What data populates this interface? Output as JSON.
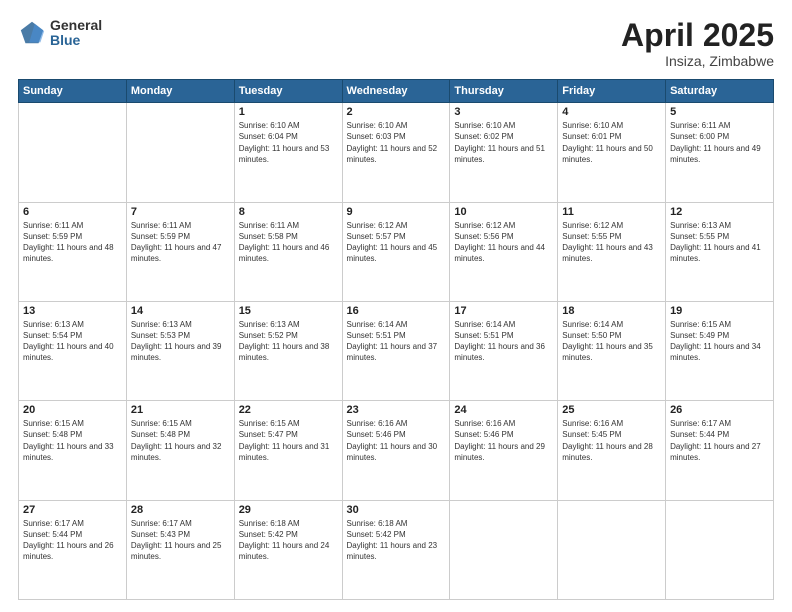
{
  "logo": {
    "general": "General",
    "blue": "Blue"
  },
  "title": {
    "month": "April 2025",
    "location": "Insiza, Zimbabwe"
  },
  "calendar": {
    "headers": [
      "Sunday",
      "Monday",
      "Tuesday",
      "Wednesday",
      "Thursday",
      "Friday",
      "Saturday"
    ],
    "weeks": [
      [
        {
          "day": "",
          "sunrise": "",
          "sunset": "",
          "daylight": ""
        },
        {
          "day": "",
          "sunrise": "",
          "sunset": "",
          "daylight": ""
        },
        {
          "day": "1",
          "sunrise": "Sunrise: 6:10 AM",
          "sunset": "Sunset: 6:04 PM",
          "daylight": "Daylight: 11 hours and 53 minutes."
        },
        {
          "day": "2",
          "sunrise": "Sunrise: 6:10 AM",
          "sunset": "Sunset: 6:03 PM",
          "daylight": "Daylight: 11 hours and 52 minutes."
        },
        {
          "day": "3",
          "sunrise": "Sunrise: 6:10 AM",
          "sunset": "Sunset: 6:02 PM",
          "daylight": "Daylight: 11 hours and 51 minutes."
        },
        {
          "day": "4",
          "sunrise": "Sunrise: 6:10 AM",
          "sunset": "Sunset: 6:01 PM",
          "daylight": "Daylight: 11 hours and 50 minutes."
        },
        {
          "day": "5",
          "sunrise": "Sunrise: 6:11 AM",
          "sunset": "Sunset: 6:00 PM",
          "daylight": "Daylight: 11 hours and 49 minutes."
        }
      ],
      [
        {
          "day": "6",
          "sunrise": "Sunrise: 6:11 AM",
          "sunset": "Sunset: 5:59 PM",
          "daylight": "Daylight: 11 hours and 48 minutes."
        },
        {
          "day": "7",
          "sunrise": "Sunrise: 6:11 AM",
          "sunset": "Sunset: 5:59 PM",
          "daylight": "Daylight: 11 hours and 47 minutes."
        },
        {
          "day": "8",
          "sunrise": "Sunrise: 6:11 AM",
          "sunset": "Sunset: 5:58 PM",
          "daylight": "Daylight: 11 hours and 46 minutes."
        },
        {
          "day": "9",
          "sunrise": "Sunrise: 6:12 AM",
          "sunset": "Sunset: 5:57 PM",
          "daylight": "Daylight: 11 hours and 45 minutes."
        },
        {
          "day": "10",
          "sunrise": "Sunrise: 6:12 AM",
          "sunset": "Sunset: 5:56 PM",
          "daylight": "Daylight: 11 hours and 44 minutes."
        },
        {
          "day": "11",
          "sunrise": "Sunrise: 6:12 AM",
          "sunset": "Sunset: 5:55 PM",
          "daylight": "Daylight: 11 hours and 43 minutes."
        },
        {
          "day": "12",
          "sunrise": "Sunrise: 6:13 AM",
          "sunset": "Sunset: 5:55 PM",
          "daylight": "Daylight: 11 hours and 41 minutes."
        }
      ],
      [
        {
          "day": "13",
          "sunrise": "Sunrise: 6:13 AM",
          "sunset": "Sunset: 5:54 PM",
          "daylight": "Daylight: 11 hours and 40 minutes."
        },
        {
          "day": "14",
          "sunrise": "Sunrise: 6:13 AM",
          "sunset": "Sunset: 5:53 PM",
          "daylight": "Daylight: 11 hours and 39 minutes."
        },
        {
          "day": "15",
          "sunrise": "Sunrise: 6:13 AM",
          "sunset": "Sunset: 5:52 PM",
          "daylight": "Daylight: 11 hours and 38 minutes."
        },
        {
          "day": "16",
          "sunrise": "Sunrise: 6:14 AM",
          "sunset": "Sunset: 5:51 PM",
          "daylight": "Daylight: 11 hours and 37 minutes."
        },
        {
          "day": "17",
          "sunrise": "Sunrise: 6:14 AM",
          "sunset": "Sunset: 5:51 PM",
          "daylight": "Daylight: 11 hours and 36 minutes."
        },
        {
          "day": "18",
          "sunrise": "Sunrise: 6:14 AM",
          "sunset": "Sunset: 5:50 PM",
          "daylight": "Daylight: 11 hours and 35 minutes."
        },
        {
          "day": "19",
          "sunrise": "Sunrise: 6:15 AM",
          "sunset": "Sunset: 5:49 PM",
          "daylight": "Daylight: 11 hours and 34 minutes."
        }
      ],
      [
        {
          "day": "20",
          "sunrise": "Sunrise: 6:15 AM",
          "sunset": "Sunset: 5:48 PM",
          "daylight": "Daylight: 11 hours and 33 minutes."
        },
        {
          "day": "21",
          "sunrise": "Sunrise: 6:15 AM",
          "sunset": "Sunset: 5:48 PM",
          "daylight": "Daylight: 11 hours and 32 minutes."
        },
        {
          "day": "22",
          "sunrise": "Sunrise: 6:15 AM",
          "sunset": "Sunset: 5:47 PM",
          "daylight": "Daylight: 11 hours and 31 minutes."
        },
        {
          "day": "23",
          "sunrise": "Sunrise: 6:16 AM",
          "sunset": "Sunset: 5:46 PM",
          "daylight": "Daylight: 11 hours and 30 minutes."
        },
        {
          "day": "24",
          "sunrise": "Sunrise: 6:16 AM",
          "sunset": "Sunset: 5:46 PM",
          "daylight": "Daylight: 11 hours and 29 minutes."
        },
        {
          "day": "25",
          "sunrise": "Sunrise: 6:16 AM",
          "sunset": "Sunset: 5:45 PM",
          "daylight": "Daylight: 11 hours and 28 minutes."
        },
        {
          "day": "26",
          "sunrise": "Sunrise: 6:17 AM",
          "sunset": "Sunset: 5:44 PM",
          "daylight": "Daylight: 11 hours and 27 minutes."
        }
      ],
      [
        {
          "day": "27",
          "sunrise": "Sunrise: 6:17 AM",
          "sunset": "Sunset: 5:44 PM",
          "daylight": "Daylight: 11 hours and 26 minutes."
        },
        {
          "day": "28",
          "sunrise": "Sunrise: 6:17 AM",
          "sunset": "Sunset: 5:43 PM",
          "daylight": "Daylight: 11 hours and 25 minutes."
        },
        {
          "day": "29",
          "sunrise": "Sunrise: 6:18 AM",
          "sunset": "Sunset: 5:42 PM",
          "daylight": "Daylight: 11 hours and 24 minutes."
        },
        {
          "day": "30",
          "sunrise": "Sunrise: 6:18 AM",
          "sunset": "Sunset: 5:42 PM",
          "daylight": "Daylight: 11 hours and 23 minutes."
        },
        {
          "day": "",
          "sunrise": "",
          "sunset": "",
          "daylight": ""
        },
        {
          "day": "",
          "sunrise": "",
          "sunset": "",
          "daylight": ""
        },
        {
          "day": "",
          "sunrise": "",
          "sunset": "",
          "daylight": ""
        }
      ]
    ]
  }
}
